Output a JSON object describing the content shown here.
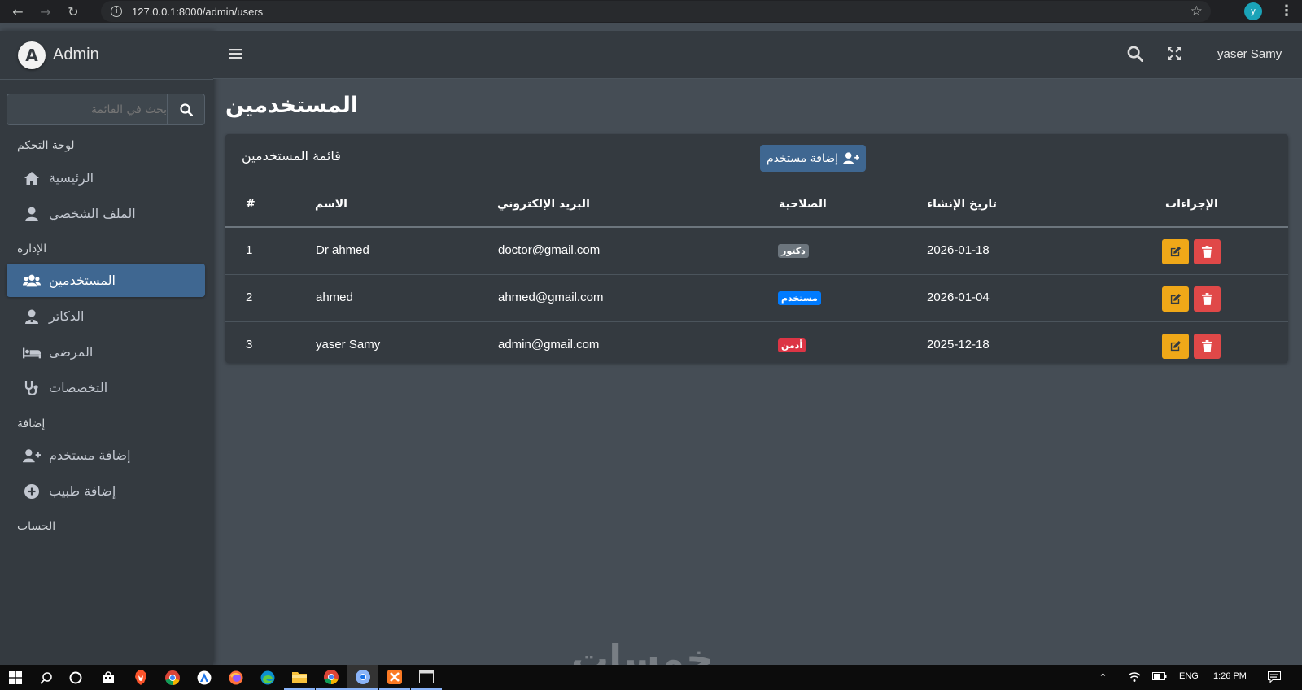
{
  "browser": {
    "url": "127.0.0.1:8000/admin/users",
    "profile_initial": "y"
  },
  "brand": {
    "logo_letter": "A",
    "name": "Admin"
  },
  "sidebar": {
    "search_placeholder": "بحث في القائمة",
    "sections": [
      {
        "header": "لوحة التحكم",
        "items": [
          {
            "label": "الرئيسية",
            "icon": "home-icon"
          },
          {
            "label": "الملف الشخصي",
            "icon": "user-icon"
          }
        ]
      },
      {
        "header": "الإدارة",
        "items": [
          {
            "label": "المستخدمين",
            "icon": "users-icon",
            "active": true
          },
          {
            "label": "الدكاتر",
            "icon": "doctor-icon"
          },
          {
            "label": "المرضى",
            "icon": "bed-icon"
          },
          {
            "label": "التخصصات",
            "icon": "stethoscope-icon"
          }
        ]
      },
      {
        "header": "إضافة",
        "items": [
          {
            "label": "إضافة مستخدم",
            "icon": "user-plus-icon"
          },
          {
            "label": "إضافة طبيب",
            "icon": "plus-circle-icon"
          }
        ]
      },
      {
        "header": "الحساب",
        "items": []
      }
    ]
  },
  "topnav": {
    "user_name": "yaser Samy"
  },
  "page": {
    "title": "المستخدمين"
  },
  "card": {
    "title": "قائمة المستخدمين",
    "add_button": "إضافة مستخدم",
    "columns": [
      "#",
      "الاسم",
      "البريد الإلكتروني",
      "الصلاحية",
      "تاريخ الإنشاء",
      "الإجراءات"
    ],
    "rows": [
      {
        "id": "1",
        "name": "Dr ahmed",
        "email": "doctor@gmail.com",
        "role": "دكتور",
        "role_color": "#6c757d",
        "created": "2026-01-18"
      },
      {
        "id": "2",
        "name": "ahmed",
        "email": "ahmed@gmail.com",
        "role": "مستخدم",
        "role_color": "#007bff",
        "created": "2026-01-04"
      },
      {
        "id": "3",
        "name": "yaser Samy",
        "email": "admin@gmail.com",
        "role": "أدمن",
        "role_color": "#dc3545",
        "created": "2025-12-18"
      }
    ]
  },
  "taskbar": {
    "language": "ENG",
    "time": "1:26 PM"
  },
  "watermark": "خمسات",
  "colors": {
    "sidebar_bg": "#343a40",
    "content_bg": "#454d55",
    "active_item": "#3f6791",
    "edit_btn": "#f0a818",
    "delete_btn": "#e04848"
  }
}
